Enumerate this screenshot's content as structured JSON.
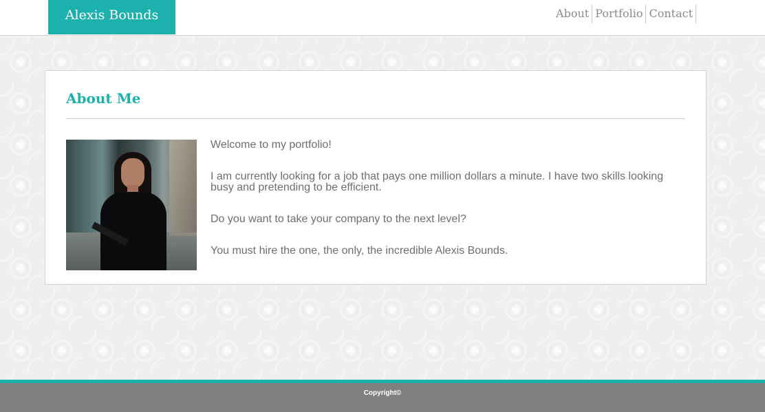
{
  "header": {
    "brand": "Alexis Bounds",
    "nav": [
      {
        "label": "About"
      },
      {
        "label": "Portfolio"
      },
      {
        "label": "Contact"
      }
    ]
  },
  "about": {
    "title": "About Me",
    "paragraphs": [
      "Welcome to my portfolio!",
      "I am currently looking for a job that pays one million dollars a minute. I have two skills looking busy and pretending to be efficient.",
      "Do you want to take your company to the next level?",
      "You must hire the one, the only, the incredible Alexis Bounds."
    ]
  },
  "footer": {
    "copyright": "Copyright©"
  },
  "colors": {
    "accent": "#1db1ad",
    "footer_bg": "#808080",
    "text": "#6e6e6e",
    "nav_text": "#8a8a8a"
  }
}
